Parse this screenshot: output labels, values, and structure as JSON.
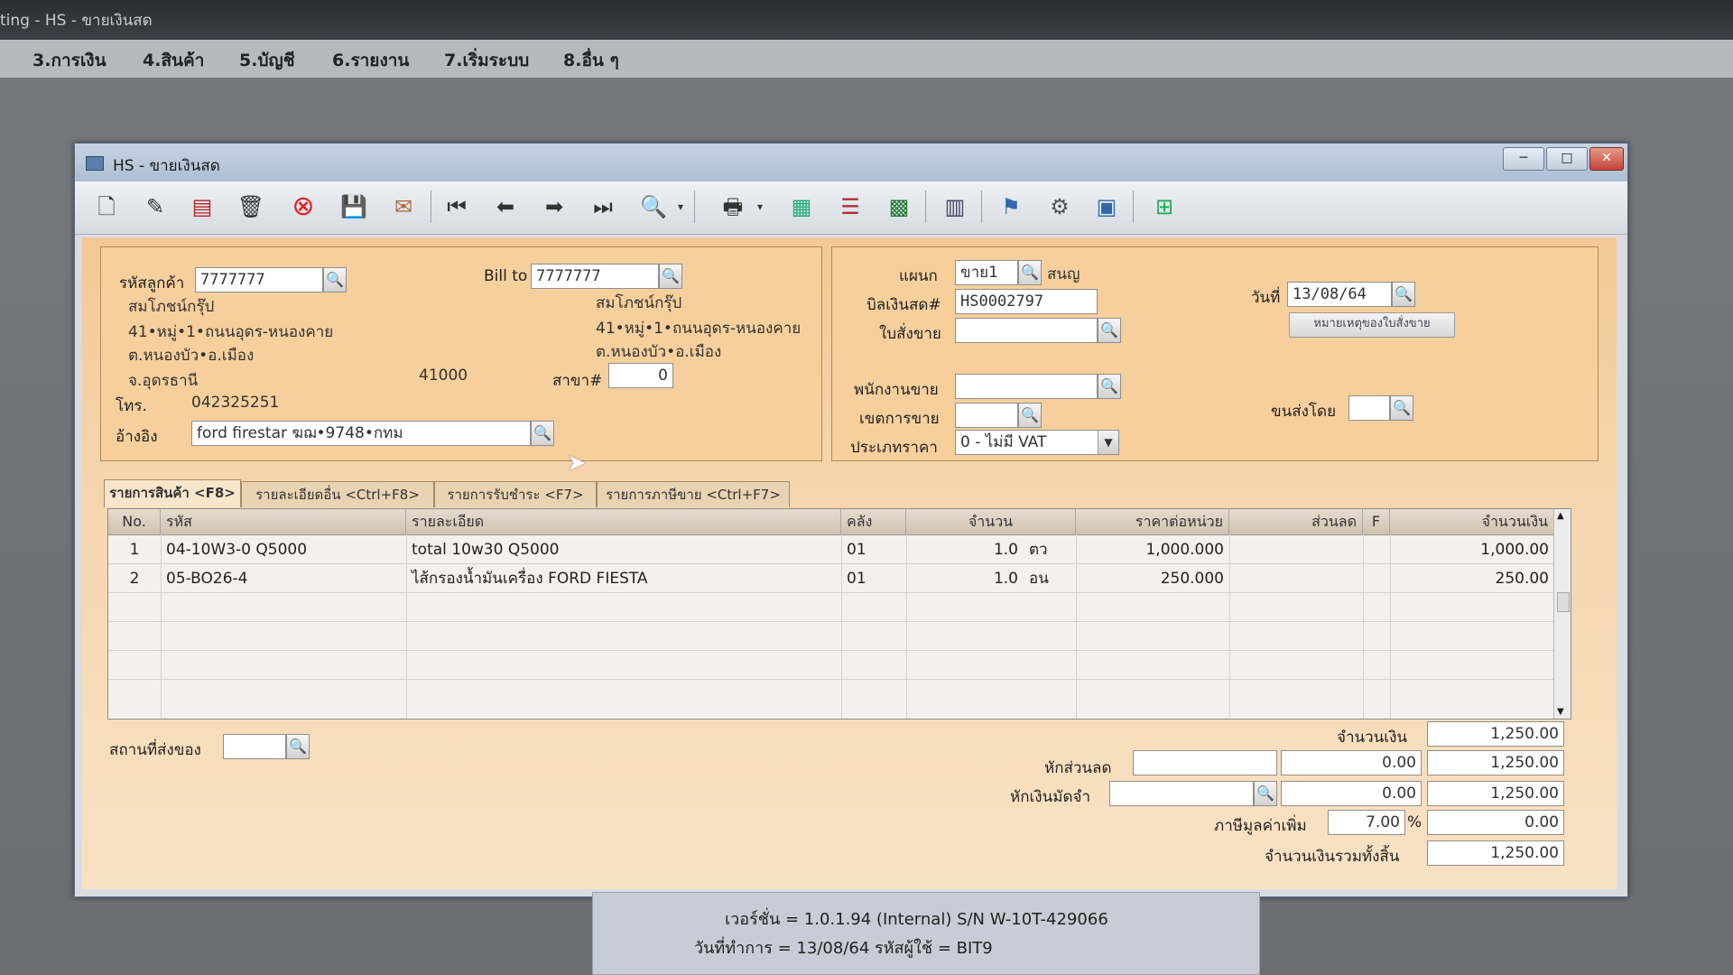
{
  "app": {
    "title": "ting - HS - ขายเงินสด",
    "menu": [
      "3.การเงิน",
      "4.สินค้า",
      "5.บัญชี",
      "6.รายงาน",
      "7.เริ่มระบบ",
      "8.อื่น ๆ"
    ]
  },
  "window": {
    "title": "HS - ขายเงินสด",
    "controls": {
      "minimize": "─",
      "maximize": "□",
      "close": "✕"
    }
  },
  "toolbar": {
    "icons": [
      "new-doc-icon",
      "edit-icon",
      "void-icon",
      "trash-icon",
      "cancel-icon",
      "save-icon",
      "attach-icon",
      "first-icon",
      "prev-icon",
      "next-icon",
      "last-icon",
      "search-doc-icon",
      "dropdown-arrow-icon",
      "print-icon",
      "dropdown-arrow-icon",
      "calculator-icon",
      "list-icon",
      "table-icon",
      "approve-icon",
      "ok-icon",
      "settings-ok-icon",
      "ok-stamp-icon",
      "calc-plus-icon"
    ]
  },
  "customer": {
    "code_label": "รหัสลูกค้า",
    "code": "7777777",
    "name": "สมโภชน์กรุ๊ป",
    "addr1": "41•หมู่•1•ถนนอุดร-หนองคาย",
    "addr2": "ต.หนองบัว•อ.เมือง",
    "province": "จ.อุดรธานี",
    "zip": "41000",
    "tel_label": "โทร.",
    "tel": "042325251",
    "ref_label": "อ้างอิง",
    "ref": "ford firestar ฆฌ•9748•กทม",
    "bill_to_label": "Bill to",
    "bill_to": "7777777",
    "bill_name": "สมโภชน์กรุ๊ป",
    "bill_addr1": "41•หมู่•1•ถนนอุดร-หนองคาย",
    "bill_addr2": "ต.หนองบัว•อ.เมือง",
    "branch_label": "สาขา#",
    "branch": "0"
  },
  "doc": {
    "dept_label": "แผนก",
    "dept": "ขาย1",
    "dept_name": "สนญ",
    "bill_no_label": "บิลเงินสด#",
    "bill_no": "HS0002797",
    "order_label": "ใบสั่งขาย",
    "order": "",
    "date_label": "วันที่",
    "date": "13/08/64",
    "note_button": "หมายเหตุของใบสั่งขาย",
    "salesman_label": "พนักงานขาย",
    "salesman": "",
    "area_label": "เขตการขาย",
    "area": "",
    "ship_by_label": "ขนส่งโดย",
    "ship_by": "",
    "price_type_label": "ประเภทราคา",
    "price_type": "0 - ไม่มี VAT"
  },
  "tabs": [
    "รายการสินค้า <F8>",
    "รายละเอียดอื่น <Ctrl+F8>",
    "รายการรับชำระ <F7>",
    "รายการภาษีขาย <Ctrl+F7>"
  ],
  "grid": {
    "headers": [
      "No.",
      "รหัส",
      "รายละเอียด",
      "คลัง",
      "จำนวน",
      "ราคาต่อหน่วย",
      "ส่วนลด",
      "F",
      "จำนวนเงิน"
    ],
    "rows": [
      {
        "no": "1",
        "code": "04-10W3-0 Q5000",
        "desc": "total 10w30 Q5000",
        "wh": "01",
        "qty": "1.0",
        "unit": "ตว",
        "price": "1,000.000",
        "disc": "",
        "f": "",
        "amount": "1,000.00"
      },
      {
        "no": "2",
        "code": "05-BO26-4",
        "desc": "ไส้กรองน้ำมันเครื่อง FORD FIESTA",
        "wh": "01",
        "qty": "1.0",
        "unit": "อน",
        "price": "250.000",
        "disc": "",
        "f": "",
        "amount": "250.00"
      }
    ]
  },
  "footer": {
    "ship_place_label": "สถานที่ส่งของ",
    "ship_place": "",
    "amount_label": "จำนวนเงิน",
    "amount": "1,250.00",
    "discount_label": "หักส่วนลด",
    "discount_pct": "",
    "discount_amt": "0.00",
    "after_discount": "1,250.00",
    "deposit_label": "หักเงินมัดจำ",
    "deposit_ref": "",
    "deposit_amt": "0.00",
    "after_deposit": "1,250.00",
    "vat_label": "ภาษีมูลค่าเพิ่ม",
    "vat_rate": "7.00",
    "vat_pct_sign": "%",
    "vat_amt": "0.00",
    "total_label": "จำนวนเงินรวมทั้งสิ้น",
    "total": "1,250.00"
  },
  "status": {
    "line1": "เวอร์ชั่น  =  1.0.1.94 (Internal)      S/N W-10T-429066",
    "line2": "วันที่ทำการ  =  13/08/64      รหัสผู้ใช้  =  BIT9"
  }
}
